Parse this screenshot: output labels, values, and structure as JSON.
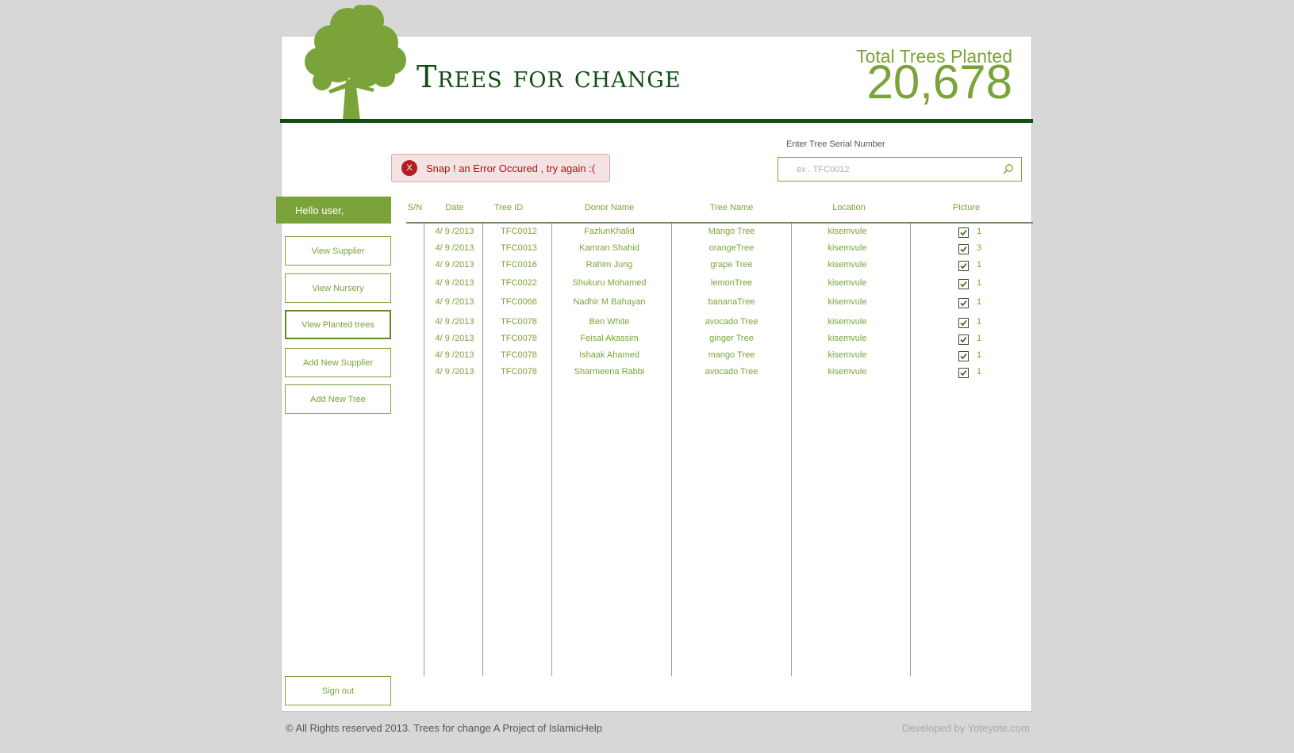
{
  "brand": {
    "name": "Trees for change",
    "color": "#7aa339",
    "dark_color": "#0f4d12"
  },
  "stats": {
    "label": "Total Trees Planted",
    "count": "20,678"
  },
  "alert": {
    "icon": "X",
    "message": "Snap ! an Error Occured , try again :("
  },
  "search": {
    "label": "Enter Tree Serial Number",
    "placeholder": "ex . TFC0012",
    "value": ""
  },
  "sidebar": {
    "greeting": "Hello user,",
    "items": [
      {
        "label": "View Supplier"
      },
      {
        "label": "View Nursery"
      },
      {
        "label": "View Planted trees",
        "active": true
      },
      {
        "label": "Add New Supplier"
      },
      {
        "label": "Add New Tree"
      }
    ],
    "signout": "Sign out"
  },
  "table": {
    "columns": [
      "S/N",
      "Date",
      "Tree ID",
      "Donor Name",
      "Tree Name",
      "Location",
      "Picture"
    ],
    "rows": [
      {
        "date": "4/ 9 /2013",
        "tree_id": "TFC0012",
        "donor": "FazlunKhalid",
        "tree": "Mango Tree",
        "location": "kisemvule",
        "picture_checked": true,
        "picture_count": "1"
      },
      {
        "date": "4/ 9 /2013",
        "tree_id": "TFC0013",
        "donor": "Kamran Shahid",
        "tree": "orangeTree",
        "location": "kisemvule",
        "picture_checked": true,
        "picture_count": "3"
      },
      {
        "date": "4/ 9 /2013",
        "tree_id": "TFC0016",
        "donor": "Rahim Jung",
        "tree": "grape Tree",
        "location": "kisemvule",
        "picture_checked": true,
        "picture_count": "1"
      },
      {
        "date": "4/ 9 /2013",
        "tree_id": "TFC0022",
        "donor": "Shukuru Mohamed",
        "tree": "lemonTree",
        "location": "kisemvule",
        "picture_checked": true,
        "picture_count": "1"
      },
      {
        "date": "4/ 9 /2013",
        "tree_id": "TFC0066",
        "donor": "Nadhir M Bahayan",
        "tree": "bananaTree",
        "location": "kisemvule",
        "picture_checked": true,
        "picture_count": "1"
      },
      {
        "date": "4/ 9 /2013",
        "tree_id": "TFC0078",
        "donor": "Ben White",
        "tree": "avocado Tree",
        "location": "kisemvule",
        "picture_checked": true,
        "picture_count": "1"
      },
      {
        "date": "4/ 9 /2013",
        "tree_id": "TFC0078",
        "donor": "Feisal Akassim",
        "tree": "ginger Tree",
        "location": "kisemvule",
        "picture_checked": true,
        "picture_count": "1"
      },
      {
        "date": "4/ 9 /2013",
        "tree_id": "TFC0078",
        "donor": "Ishaak Ahamed",
        "tree": "mango Tree",
        "location": "kisemvule",
        "picture_checked": true,
        "picture_count": "1"
      },
      {
        "date": "4/ 9 /2013",
        "tree_id": "TFC0078",
        "donor": "Sharmeena Rabbi",
        "tree": "avocado Tree",
        "location": "kisemvule",
        "picture_checked": true,
        "picture_count": "1"
      }
    ]
  },
  "footer": {
    "copyright": "© All Rights reserved 2013. Trees for change A Project of IslamicHelp",
    "developer": "Developed by Yoteyote.com"
  },
  "icons": {
    "logo": "tree-icon",
    "search": "search-icon",
    "error": "error-icon",
    "checkbox": "checkbox-checked-icon"
  }
}
